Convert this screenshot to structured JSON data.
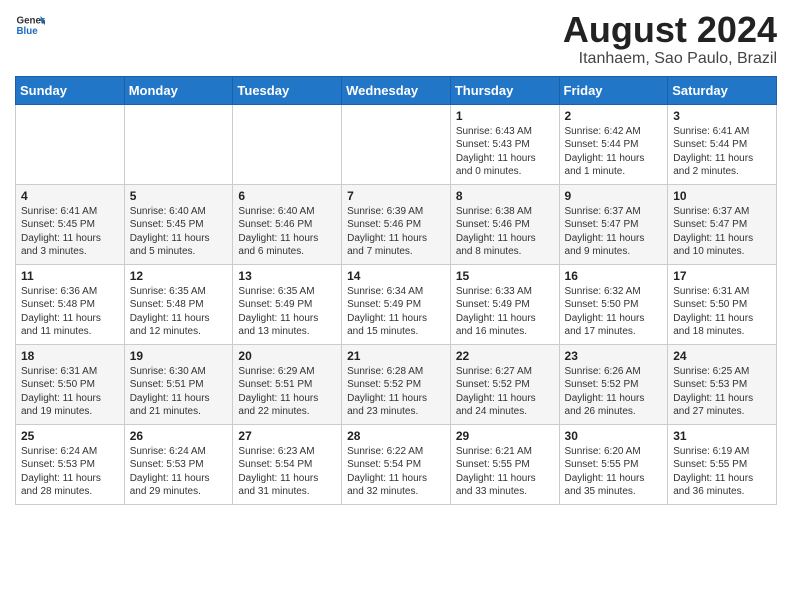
{
  "header": {
    "logo_general": "General",
    "logo_blue": "Blue",
    "month_title": "August 2024",
    "subtitle": "Itanhaem, Sao Paulo, Brazil"
  },
  "days_of_week": [
    "Sunday",
    "Monday",
    "Tuesday",
    "Wednesday",
    "Thursday",
    "Friday",
    "Saturday"
  ],
  "weeks": [
    [
      {
        "day": "",
        "info": ""
      },
      {
        "day": "",
        "info": ""
      },
      {
        "day": "",
        "info": ""
      },
      {
        "day": "",
        "info": ""
      },
      {
        "day": "1",
        "info": "Sunrise: 6:43 AM\nSunset: 5:43 PM\nDaylight: 11 hours and 0 minutes."
      },
      {
        "day": "2",
        "info": "Sunrise: 6:42 AM\nSunset: 5:44 PM\nDaylight: 11 hours and 1 minute."
      },
      {
        "day": "3",
        "info": "Sunrise: 6:41 AM\nSunset: 5:44 PM\nDaylight: 11 hours and 2 minutes."
      }
    ],
    [
      {
        "day": "4",
        "info": "Sunrise: 6:41 AM\nSunset: 5:45 PM\nDaylight: 11 hours and 3 minutes."
      },
      {
        "day": "5",
        "info": "Sunrise: 6:40 AM\nSunset: 5:45 PM\nDaylight: 11 hours and 5 minutes."
      },
      {
        "day": "6",
        "info": "Sunrise: 6:40 AM\nSunset: 5:46 PM\nDaylight: 11 hours and 6 minutes."
      },
      {
        "day": "7",
        "info": "Sunrise: 6:39 AM\nSunset: 5:46 PM\nDaylight: 11 hours and 7 minutes."
      },
      {
        "day": "8",
        "info": "Sunrise: 6:38 AM\nSunset: 5:46 PM\nDaylight: 11 hours and 8 minutes."
      },
      {
        "day": "9",
        "info": "Sunrise: 6:37 AM\nSunset: 5:47 PM\nDaylight: 11 hours and 9 minutes."
      },
      {
        "day": "10",
        "info": "Sunrise: 6:37 AM\nSunset: 5:47 PM\nDaylight: 11 hours and 10 minutes."
      }
    ],
    [
      {
        "day": "11",
        "info": "Sunrise: 6:36 AM\nSunset: 5:48 PM\nDaylight: 11 hours and 11 minutes."
      },
      {
        "day": "12",
        "info": "Sunrise: 6:35 AM\nSunset: 5:48 PM\nDaylight: 11 hours and 12 minutes."
      },
      {
        "day": "13",
        "info": "Sunrise: 6:35 AM\nSunset: 5:49 PM\nDaylight: 11 hours and 13 minutes."
      },
      {
        "day": "14",
        "info": "Sunrise: 6:34 AM\nSunset: 5:49 PM\nDaylight: 11 hours and 15 minutes."
      },
      {
        "day": "15",
        "info": "Sunrise: 6:33 AM\nSunset: 5:49 PM\nDaylight: 11 hours and 16 minutes."
      },
      {
        "day": "16",
        "info": "Sunrise: 6:32 AM\nSunset: 5:50 PM\nDaylight: 11 hours and 17 minutes."
      },
      {
        "day": "17",
        "info": "Sunrise: 6:31 AM\nSunset: 5:50 PM\nDaylight: 11 hours and 18 minutes."
      }
    ],
    [
      {
        "day": "18",
        "info": "Sunrise: 6:31 AM\nSunset: 5:50 PM\nDaylight: 11 hours and 19 minutes."
      },
      {
        "day": "19",
        "info": "Sunrise: 6:30 AM\nSunset: 5:51 PM\nDaylight: 11 hours and 21 minutes."
      },
      {
        "day": "20",
        "info": "Sunrise: 6:29 AM\nSunset: 5:51 PM\nDaylight: 11 hours and 22 minutes."
      },
      {
        "day": "21",
        "info": "Sunrise: 6:28 AM\nSunset: 5:52 PM\nDaylight: 11 hours and 23 minutes."
      },
      {
        "day": "22",
        "info": "Sunrise: 6:27 AM\nSunset: 5:52 PM\nDaylight: 11 hours and 24 minutes."
      },
      {
        "day": "23",
        "info": "Sunrise: 6:26 AM\nSunset: 5:52 PM\nDaylight: 11 hours and 26 minutes."
      },
      {
        "day": "24",
        "info": "Sunrise: 6:25 AM\nSunset: 5:53 PM\nDaylight: 11 hours and 27 minutes."
      }
    ],
    [
      {
        "day": "25",
        "info": "Sunrise: 6:24 AM\nSunset: 5:53 PM\nDaylight: 11 hours and 28 minutes."
      },
      {
        "day": "26",
        "info": "Sunrise: 6:24 AM\nSunset: 5:53 PM\nDaylight: 11 hours and 29 minutes."
      },
      {
        "day": "27",
        "info": "Sunrise: 6:23 AM\nSunset: 5:54 PM\nDaylight: 11 hours and 31 minutes."
      },
      {
        "day": "28",
        "info": "Sunrise: 6:22 AM\nSunset: 5:54 PM\nDaylight: 11 hours and 32 minutes."
      },
      {
        "day": "29",
        "info": "Sunrise: 6:21 AM\nSunset: 5:55 PM\nDaylight: 11 hours and 33 minutes."
      },
      {
        "day": "30",
        "info": "Sunrise: 6:20 AM\nSunset: 5:55 PM\nDaylight: 11 hours and 35 minutes."
      },
      {
        "day": "31",
        "info": "Sunrise: 6:19 AM\nSunset: 5:55 PM\nDaylight: 11 hours and 36 minutes."
      }
    ]
  ]
}
